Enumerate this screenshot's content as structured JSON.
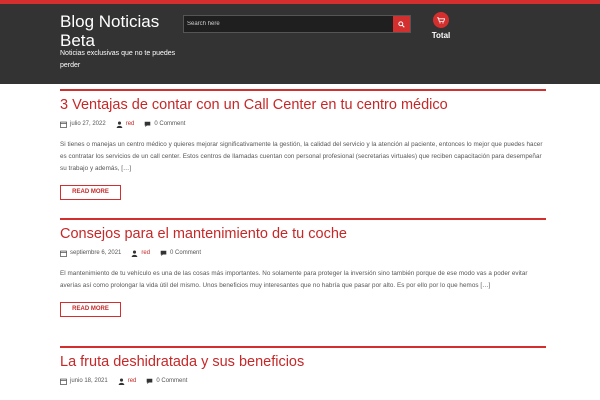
{
  "header": {
    "site_title": "Blog Noticias Beta",
    "tagline": "Noticias exclusivas que no te puedes perder",
    "search_placeholder": "Search here",
    "cart_total_label": "Total"
  },
  "colors": {
    "accent": "#d32f2f",
    "header_bg": "#333333"
  },
  "posts": [
    {
      "title": "3 Ventajas de contar con un Call Center en tu centro médico",
      "date": "julio 27, 2022",
      "author": "red",
      "comments": "0 Comment",
      "excerpt": "Si tienes o manejas un centro médico y quieres mejorar significativamente la gestión, la calidad del servicio y la atención al paciente, entonces lo mejor que puedes hacer es contratar los servicios de un call center. Estos centros de llamadas cuentan con personal profesional (secretarias virtuales) que reciben capacitación para desempeñar su trabajo y además, […]",
      "read_more": "READ MORE"
    },
    {
      "title": "Consejos para el mantenimiento de tu coche",
      "date": "septiembre 6, 2021",
      "author": "red",
      "comments": "0 Comment",
      "excerpt": "El mantenimiento de tu vehículo es una de las cosas más importantes. No solamente para proteger la inversión sino también porque de ese modo vas a poder evitar averías así como prolongar la vida útil del mismo. Unos beneficios muy interesantes que no habría que pasar por alto. Es por ello por lo que hemos […]",
      "read_more": "READ MORE"
    },
    {
      "title": "La fruta deshidratada y sus beneficios",
      "date": "junio 18, 2021",
      "author": "red",
      "comments": "0 Comment",
      "excerpt": "",
      "read_more": ""
    }
  ]
}
